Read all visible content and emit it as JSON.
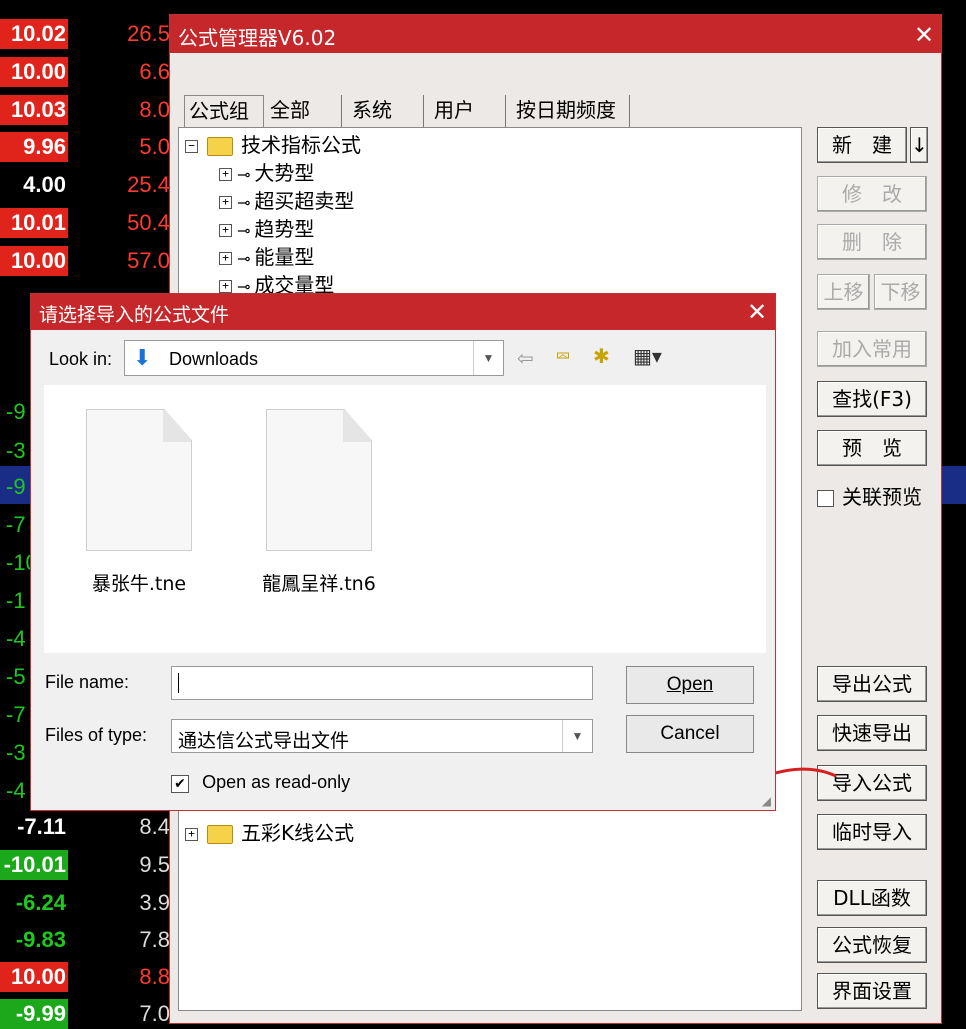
{
  "bg": {
    "rows": [
      {
        "c1": "10.02",
        "c2": "26.5",
        "k1": "red",
        "k2": "red"
      },
      {
        "c1": "10.00",
        "c2": "6.6",
        "k1": "red",
        "k2": "red"
      },
      {
        "c1": "10.03",
        "c2": "8.0",
        "k1": "red",
        "k2": "red"
      },
      {
        "c1": "9.96",
        "c2": "5.0",
        "k1": "red",
        "k2": "red"
      },
      {
        "c1": "4.00",
        "c2": "25.4",
        "k1": "plain-white",
        "k2": "red"
      },
      {
        "c1": "10.01",
        "c2": "50.4",
        "k1": "red",
        "k2": "red"
      },
      {
        "c1": "10.00",
        "c2": "57.0",
        "k1": "red",
        "k2": "red"
      },
      {
        "c1": "-7.11",
        "c2": "8.4",
        "k1": "plain-white",
        "k2": "white"
      },
      {
        "c1": "-10.01",
        "c2": "9.5",
        "k1": "green",
        "k2": "white"
      },
      {
        "c1": "-6.24",
        "c2": "3.9",
        "k1": "plain-green",
        "k2": "white"
      },
      {
        "c1": "-9.83",
        "c2": "7.8",
        "k1": "plain-green",
        "k2": "white"
      },
      {
        "c1": "10.00",
        "c2": "8.8",
        "k1": "red",
        "k2": "red"
      },
      {
        "c1": "-9.99",
        "c2": "7.0",
        "k1": "green",
        "k2": "white"
      }
    ],
    "partial": [
      "-9",
      "-3",
      "-9",
      "-7",
      "-10",
      "-1",
      "-4",
      "-5",
      "-7",
      "-3",
      "-4"
    ]
  },
  "main": {
    "title": "公式管理器V6.02",
    "tabs": [
      "公式组",
      "全部",
      "系统",
      "用户",
      "按日期频度"
    ],
    "tree": {
      "root": "技术指标公式",
      "children": [
        "大势型",
        "超买超卖型",
        "趋势型",
        "能量型",
        "成交量型"
      ],
      "bottom": "五彩K线公式"
    },
    "buttons": {
      "new": "新　建",
      "arrow": "↓",
      "edit": "修　改",
      "delete": "删　除",
      "up": "上移",
      "down": "下移",
      "add_common": "加入常用",
      "find": "查找(F3)",
      "preview": "预　览",
      "link_preview": "关联预览",
      "export": "导出公式",
      "quick_export": "快速导出",
      "import": "导入公式",
      "temp_import": "临时导入",
      "dll": "DLL函数",
      "restore": "公式恢复",
      "ui_settings": "界面设置"
    }
  },
  "dialog": {
    "title": "请选择导入的公式文件",
    "look_in_label": "Look in:",
    "look_in_value": "Downloads",
    "files": [
      "暴张牛.tne",
      "龍鳳呈祥.tn6"
    ],
    "file_name_label": "File name:",
    "file_name_value": "",
    "files_type_label": "Files of type:",
    "files_type_value": "通达信公式导出文件",
    "open": "Open",
    "cancel": "Cancel",
    "readonly_label": "Open as read-only",
    "readonly_checked": "✔"
  },
  "colors": {
    "title_red": "#c6272a",
    "annotation_red": "#d81e1e"
  }
}
